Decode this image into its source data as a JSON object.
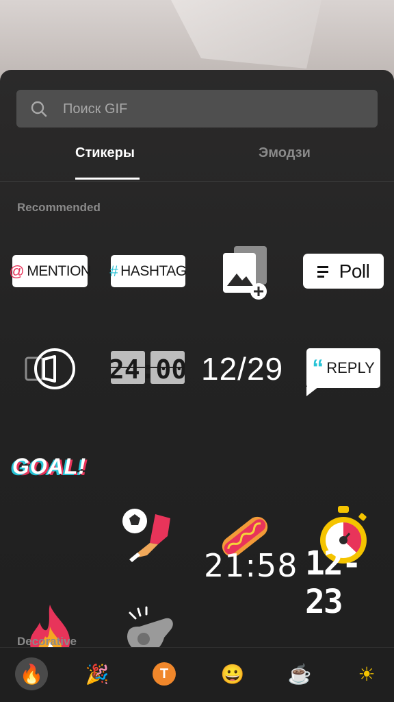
{
  "search": {
    "placeholder": "Поиск GIF"
  },
  "tabs": [
    {
      "label": "Стикеры",
      "active": true
    },
    {
      "label": "Эмодзи",
      "active": false
    }
  ],
  "sections": {
    "recommended": "Recommended",
    "decorative": "Decorative"
  },
  "stickers": {
    "mention": {
      "symbol": "@",
      "label": "MENTION"
    },
    "hashtag": {
      "symbol": "#",
      "label": "HASHTAG"
    },
    "poll": {
      "label": "Poll"
    },
    "clock_flip": "24:00",
    "date_slash": "12/29",
    "reply": {
      "quote": "“",
      "label": "REPLY"
    },
    "goal": "GOAL!",
    "time_digital": "21:58",
    "date_dash": "12-23"
  },
  "bottom_categories": [
    {
      "icon": "fire-icon",
      "glyph": "🔥",
      "selected": true
    },
    {
      "icon": "party-popper-icon",
      "glyph": "🎉",
      "selected": false
    },
    {
      "icon": "text-t-icon",
      "glyph": "T",
      "selected": false
    },
    {
      "icon": "grinning-face-icon",
      "glyph": "😀",
      "selected": false
    },
    {
      "icon": "coffee-icon",
      "glyph": "☕",
      "selected": false
    },
    {
      "icon": "sun-icon",
      "glyph": "☀",
      "selected": false
    }
  ],
  "colors": {
    "panel": "#2b2a2a",
    "search_bg": "#4f4f4f",
    "mention_accent": "#e8345a",
    "hashtag_accent": "#27c3d6",
    "reply_accent": "#27c3d6"
  }
}
